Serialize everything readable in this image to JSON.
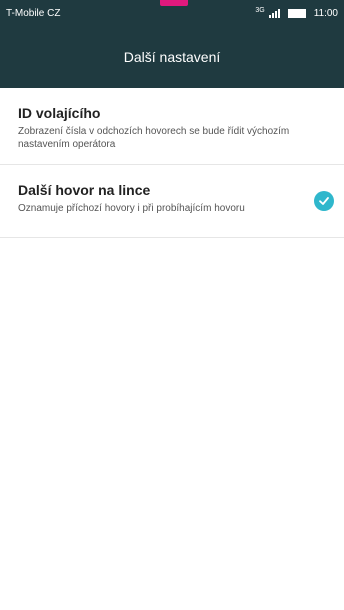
{
  "status_bar": {
    "carrier": "T-Mobile CZ",
    "network": "3G",
    "time": "11:00"
  },
  "header": {
    "title": "Další nastavení"
  },
  "settings": [
    {
      "title": "ID volajícího",
      "description": "Zobrazení čísla v odchozích hovorech se bude řídit výchozím nastavením operátora"
    },
    {
      "title": "Další hovor na lince",
      "description": "Oznamuje příchozí hovory i při probíhajícím hovoru",
      "checked": true
    }
  ],
  "colors": {
    "header_bg": "#1f3a40",
    "accent": "#2fb7cc",
    "marker": "#e0197d"
  }
}
